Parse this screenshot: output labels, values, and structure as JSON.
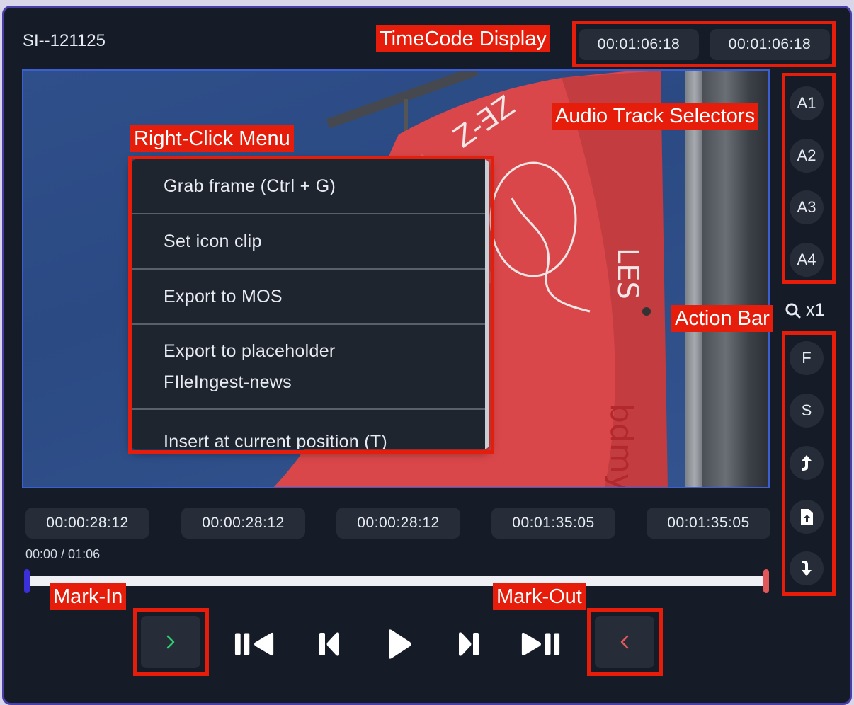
{
  "clip_title": "SI--121125",
  "header_timecodes": [
    "00:01:06:18",
    "00:01:06:18"
  ],
  "context_menu": {
    "items": [
      "Grab frame (Ctrl + G)",
      "Set icon clip",
      "Export to MOS",
      "Export to placeholder",
      "FIleIngest-news",
      "Insert at current position (T)"
    ]
  },
  "audio_tracks": [
    "A1",
    "A2",
    "A3",
    "A4"
  ],
  "zoom_label": "x1",
  "action_bar": {
    "f_label": "F",
    "s_label": "S"
  },
  "timecode_row": [
    "00:00:28:12",
    "00:00:28:12",
    "00:00:28:12",
    "00:01:35:05",
    "00:01:35:05"
  ],
  "elapsed": "00:00 / 01:06",
  "annotations": {
    "timecode_display": "TimeCode Display",
    "audio_track_selectors": "Audio Track Selectors",
    "right_click_menu": "Right-Click Menu",
    "action_bar": "Action Bar",
    "mark_in": "Mark-In",
    "mark_out": "Mark-Out"
  },
  "colors": {
    "background": "#151c28",
    "pill": "#262d39",
    "annotation": "#e61d0a",
    "mark_in": "#2ecc71",
    "mark_out": "#e2575a",
    "playhead": "#3a2fd8"
  },
  "icons": [
    "search-icon",
    "upload-arrow-icon",
    "file-upload-icon",
    "download-arrow-icon",
    "chevron-right-icon",
    "chevron-left-icon",
    "skip-to-start-icon",
    "step-back-icon",
    "play-icon",
    "step-forward-icon",
    "skip-to-end-icon"
  ]
}
